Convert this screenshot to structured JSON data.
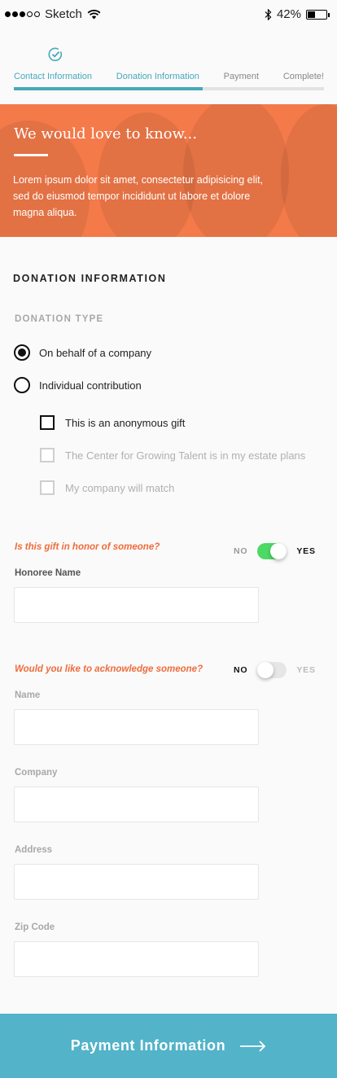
{
  "status_bar": {
    "carrier": "Sketch",
    "battery": "42%",
    "battery_level": 0.42
  },
  "stepper": {
    "steps": [
      "Contact Information",
      "Donation Information",
      "Payment",
      "Complete!"
    ],
    "active_index": 1,
    "completed_index": 0,
    "progress_fraction": 0.61,
    "accent_color": "#45a9bb"
  },
  "hero": {
    "title": "We would love to know...",
    "body": "Lorem ipsum dolor sit amet, consectetur adipisicing elit, sed do eiusmod tempor incididunt ut labore et dolore magna aliqua.",
    "color": "#f47a4a"
  },
  "form": {
    "section_title": "DONATION INFORMATION",
    "donation_type_label": "DONATION TYPE",
    "radios": [
      {
        "label": "On behalf of a company",
        "checked": true
      },
      {
        "label": "Individual contribution",
        "checked": false
      }
    ],
    "checkboxes": [
      {
        "label": "This is an anonymous gift",
        "checked": false,
        "disabled": false
      },
      {
        "label": "The Center for Growing Talent is in my estate plans",
        "checked": false,
        "disabled": true
      },
      {
        "label": "My company will match",
        "checked": false,
        "disabled": true
      }
    ],
    "honor": {
      "question": "Is this gift in honor of someone?",
      "no_label": "NO",
      "yes_label": "YES",
      "value": true,
      "field_label": "Honoree Name",
      "field_value": ""
    },
    "acknowledge": {
      "question": "Would you like to acknowledge someone?",
      "no_label": "NO",
      "yes_label": "YES",
      "value": false,
      "fields": [
        {
          "label": "Name",
          "value": ""
        },
        {
          "label": "Company",
          "value": ""
        },
        {
          "label": "Address",
          "value": ""
        },
        {
          "label": "Zip Code",
          "value": ""
        }
      ]
    }
  },
  "footer": {
    "button_label": "Payment Information",
    "color": "#52b3c9"
  }
}
